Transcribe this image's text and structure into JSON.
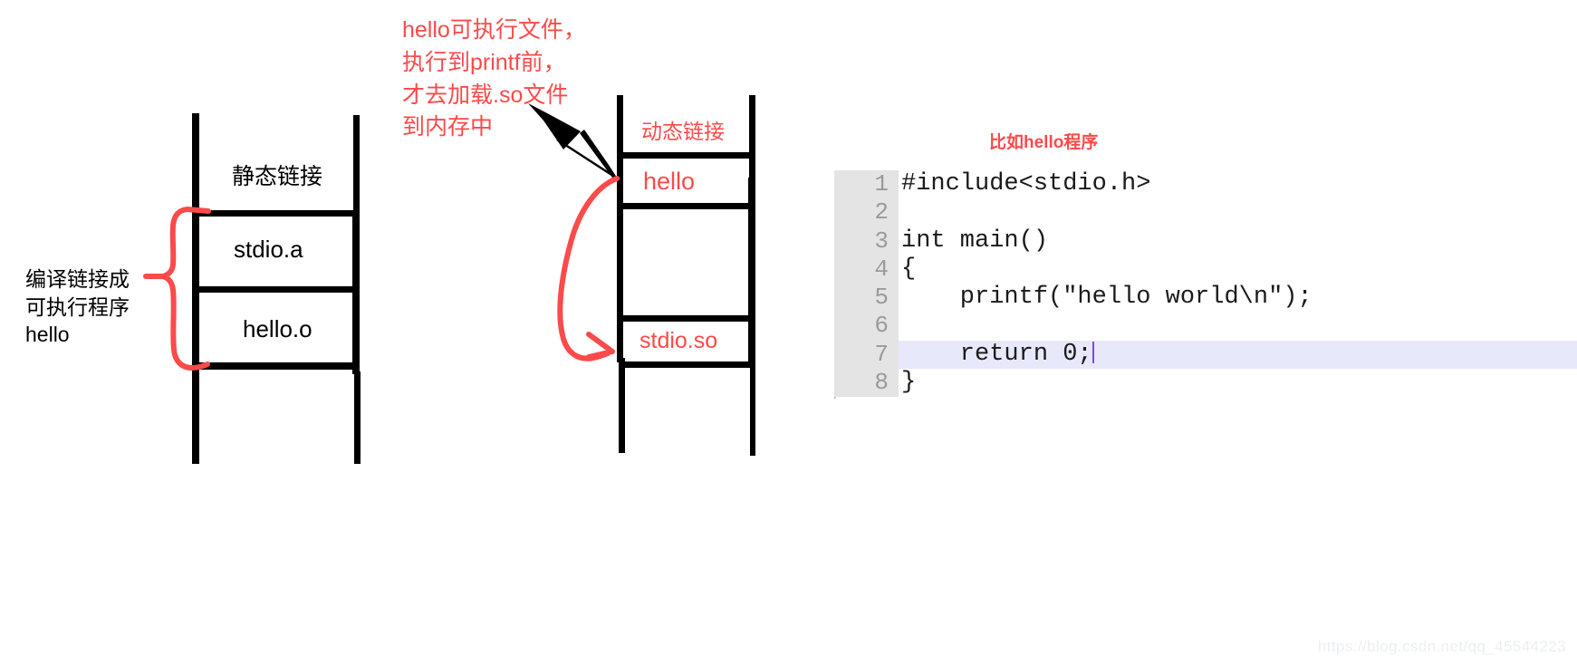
{
  "static_link_diagram": {
    "title": "静态链接",
    "rows": [
      {
        "label": "stdio.a"
      },
      {
        "label": "hello.o"
      }
    ],
    "brace_note": "编译链接成\n可执行程序\nhello"
  },
  "dynamic_link_diagram": {
    "title": "动态链接",
    "rows": [
      {
        "label": "hello"
      },
      {
        "label": "stdio.so"
      }
    ]
  },
  "annotations": {
    "dynamic_load_note": "hello可执行文件，\n执行到printf前，\n才去加载.so文件\n到内存中",
    "program_example": "比如hello程序"
  },
  "code": {
    "lines": [
      {
        "num": "1",
        "text": "#include<stdio.h>",
        "highlight": false
      },
      {
        "num": "2",
        "text": "",
        "highlight": false
      },
      {
        "num": "3",
        "text": "int main()",
        "highlight": false
      },
      {
        "num": "4",
        "text": "{",
        "highlight": false
      },
      {
        "num": "5",
        "text": "    printf(\"hello world\\n\");",
        "highlight": false
      },
      {
        "num": "6",
        "text": "",
        "highlight": false
      },
      {
        "num": "7",
        "text": "    return 0;",
        "highlight": true
      },
      {
        "num": "8",
        "text": "}",
        "highlight": false
      }
    ]
  },
  "watermark": {
    "text": "https://blog.csdn.net/qq_45544223"
  },
  "colors": {
    "red_annotation": "#fb4a4a",
    "diagram_stroke": "#000000",
    "gutter_bg": "#e4e4e4",
    "highlight_bg": "#e8e8fb",
    "caret": "#7b4fd6"
  }
}
